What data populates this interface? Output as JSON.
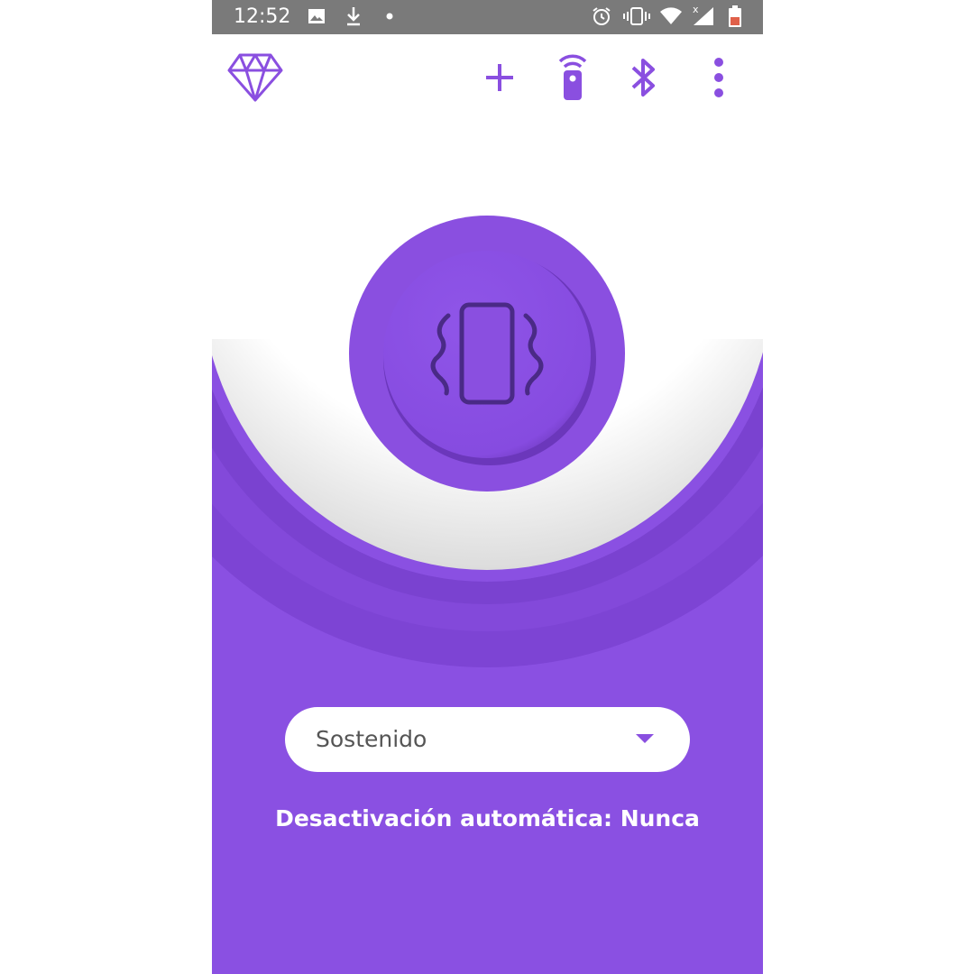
{
  "status_bar": {
    "time": "12:52",
    "icons": [
      "image-icon",
      "download-icon",
      "dot-icon",
      "alarm-icon",
      "vibrate-icon",
      "wifi-icon",
      "signal-icon",
      "battery-icon"
    ]
  },
  "app_bar": {
    "icons": [
      "diamond-icon",
      "add-icon",
      "remote-icon",
      "bluetooth-icon",
      "more-vert-icon"
    ]
  },
  "main": {
    "center_icon": "vibrating-phone-icon",
    "mode_select": {
      "value": "Sostenido"
    },
    "auto_off": {
      "text": "Desactivación automática: Nunca"
    }
  },
  "colors": {
    "accent": "#8a4fe0",
    "dark_accent": "#5a2f9a",
    "status_bar": "#7a7a7a",
    "battery_low": "#e0604a"
  }
}
